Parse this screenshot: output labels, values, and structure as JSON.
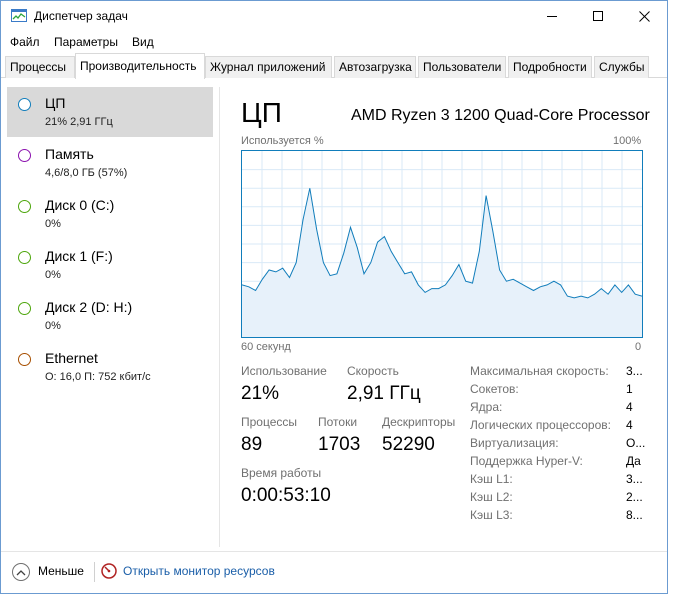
{
  "window": {
    "title": "Диспетчер задач"
  },
  "menu": {
    "items": [
      "Файл",
      "Параметры",
      "Вид"
    ]
  },
  "tabs": [
    "Процессы",
    "Производительность",
    "Журнал приложений",
    "Автозагрузка",
    "Пользователи",
    "Подробности",
    "Службы"
  ],
  "active_tab": "Производительность",
  "resources": [
    {
      "name": "ЦП",
      "sub": "21% 2,91 ГГц",
      "color": "#117dbb",
      "selected": true
    },
    {
      "name": "Память",
      "sub": "4,6/8,0 ГБ (57%)",
      "color": "#8b12ae",
      "selected": false
    },
    {
      "name": "Диск 0 (C:)",
      "sub": "0%",
      "color": "#4da60c",
      "selected": false
    },
    {
      "name": "Диск 1 (F:)",
      "sub": "0%",
      "color": "#4da60c",
      "selected": false
    },
    {
      "name": "Диск 2 (D: H:)",
      "sub": "0%",
      "color": "#4da60c",
      "selected": false
    },
    {
      "name": "Ethernet",
      "sub": "О: 16,0 П: 752 кбит/с",
      "color": "#a74f01",
      "selected": false
    }
  ],
  "main": {
    "title": "ЦП",
    "processor": "AMD Ryzen 3 1200 Quad-Core Processor",
    "graph_top_left": "Используется %",
    "graph_top_right": "100%",
    "graph_bottom_left": "60 секунд",
    "graph_bottom_right": "0"
  },
  "chart_data": {
    "type": "area",
    "ylim": [
      0,
      100
    ],
    "xlabel": "60 секунд",
    "ylabel": "Используется %",
    "grid": true,
    "color": "#117dbb",
    "fill": "#e7f1fa",
    "values": [
      28,
      27,
      25,
      31,
      36,
      35,
      37,
      32,
      40,
      63,
      80,
      58,
      40,
      33,
      34,
      45,
      59,
      48,
      34,
      40,
      51,
      54,
      46,
      40,
      34,
      35,
      28,
      24,
      26,
      26,
      28,
      33,
      39,
      30,
      29,
      46,
      76,
      57,
      36,
      30,
      31,
      29,
      27,
      25,
      27,
      28,
      30,
      28,
      22,
      21,
      22,
      21,
      23,
      26,
      23,
      28,
      24,
      28,
      23,
      22
    ]
  },
  "stats": {
    "usage_label": "Использование",
    "usage_value": "21%",
    "speed_label": "Скорость",
    "speed_value": "2,91 ГГц",
    "processes_label": "Процессы",
    "processes_value": "89",
    "threads_label": "Потоки",
    "threads_value": "1703",
    "handles_label": "Дескрипторы",
    "handles_value": "52290",
    "uptime_label": "Время работы",
    "uptime_value": "0:00:53:10"
  },
  "details": [
    {
      "key": "Максимальная скорость:",
      "value": "3..."
    },
    {
      "key": "Сокетов:",
      "value": "1"
    },
    {
      "key": "Ядра:",
      "value": "4"
    },
    {
      "key": "Логических процессоров:",
      "value": "4"
    },
    {
      "key": "Виртуализация:",
      "value": "О..."
    },
    {
      "key": "Поддержка Hyper-V:",
      "value": "Да"
    },
    {
      "key": "Кэш L1:",
      "value": "3..."
    },
    {
      "key": "Кэш L2:",
      "value": "2..."
    },
    {
      "key": "Кэш L3:",
      "value": "8..."
    }
  ],
  "bottom": {
    "fewer_label": "Меньше",
    "monitor_link": "Открыть монитор ресурсов"
  }
}
